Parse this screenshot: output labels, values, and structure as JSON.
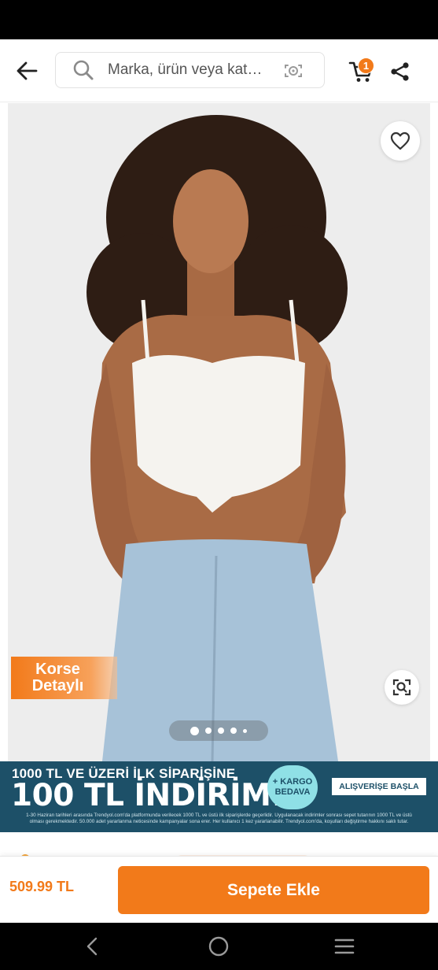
{
  "header": {
    "back_icon": "arrow-left-icon",
    "search": {
      "placeholder": "Marka, ürün veya kat…",
      "value": ""
    },
    "cart_badge_count": "1",
    "icons": [
      "search-icon",
      "camera-icon",
      "cart-icon",
      "share-icon"
    ]
  },
  "gallery": {
    "promo_badge": {
      "line1": "Korse",
      "line2": "Detaylı"
    },
    "image_count": 5,
    "active_index": 0,
    "icons": [
      "heart-icon",
      "visual-search-icon"
    ]
  },
  "banner": {
    "line1": "1000 TL VE ÜZERİ İLK SİPARİŞİNE",
    "line2": "100 TL İNDİRİM!",
    "kargo_line1": "+ KARGO",
    "kargo_line2": "BEDAVA",
    "button_label": "ALIŞVERİŞE BAŞLA",
    "fine_print_1": "1-30 Haziran tarihleri arasında Trendyol.com'da platformunda verilecek 1000 TL ve üstü ilk siparişlerde geçerlidir. Uygulanacak indirimler sonrası sepet tutarının 1000 TL ve üstü",
    "fine_print_2": "olması gerekmektedir. 50.000 adet yararlanma neticesinde kampanyalar sona erer. Her kullanıcı 1 kez yararlanabilir. Trendyol.com'da, koşulları değiştirme hakkını saklı tutar."
  },
  "bottom_bar": {
    "price": "509.99 TL",
    "add_to_cart_label": "Sepete Ekle"
  },
  "colors": {
    "brand_orange": "#f27a1a",
    "banner_bg": "#1d5068",
    "kargo_circle": "#8fe0e6"
  },
  "system_nav": [
    "back-nav-icon",
    "home-nav-icon",
    "recents-nav-icon"
  ]
}
